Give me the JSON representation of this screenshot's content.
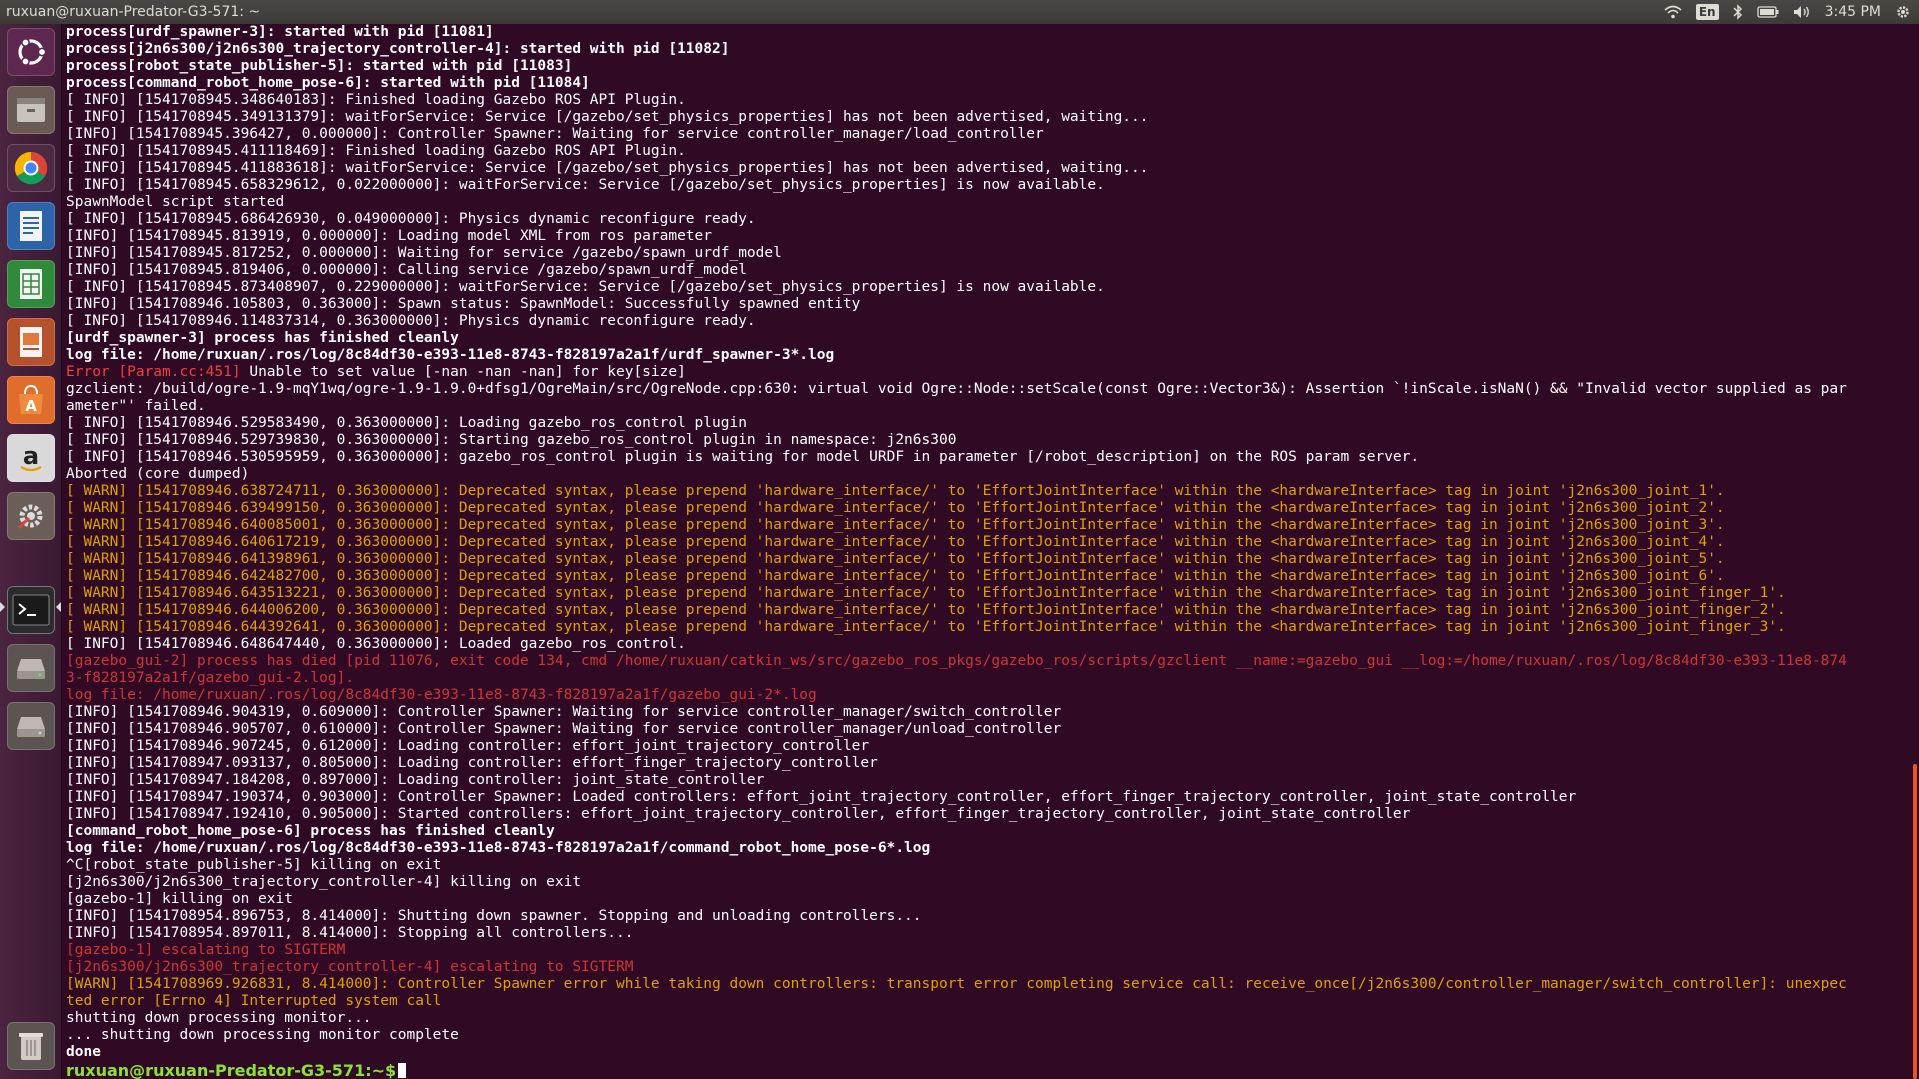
{
  "window": {
    "title": "ruxuan@ruxuan-Predator-G3-571: ~"
  },
  "tray": {
    "keyboard_layout": "En",
    "clock": "3:45 PM"
  },
  "launcher": {
    "items": [
      {
        "name": "ubuntu-dash-icon"
      },
      {
        "name": "files-icon"
      },
      {
        "name": "chrome-icon"
      },
      {
        "name": "writer-icon"
      },
      {
        "name": "calc-icon"
      },
      {
        "name": "impress-icon"
      },
      {
        "name": "software-center-icon"
      },
      {
        "name": "amazon-icon"
      },
      {
        "name": "system-settings-icon"
      },
      {
        "name": "terminal-icon"
      },
      {
        "name": "drive-icon"
      },
      {
        "name": "drive-icon-2"
      },
      {
        "name": "trash-icon"
      }
    ]
  },
  "terminal": {
    "lines": [
      {
        "style": "b",
        "text": "process[urdf_spawner-3]: started with pid [11081]"
      },
      {
        "style": "b",
        "text": "process[j2n6s300/j2n6s300_trajectory_controller-4]: started with pid [11082]"
      },
      {
        "style": "b",
        "text": "process[robot_state_publisher-5]: started with pid [11083]"
      },
      {
        "style": "b",
        "text": "process[command_robot_home_pose-6]: started with pid [11084]"
      },
      {
        "style": "n",
        "text": "[ INFO] [1541708945.348640183]: Finished loading Gazebo ROS API Plugin."
      },
      {
        "style": "n",
        "text": "[ INFO] [1541708945.349131379]: waitForService: Service [/gazebo/set_physics_properties] has not been advertised, waiting..."
      },
      {
        "style": "n",
        "text": "[INFO] [1541708945.396427, 0.000000]: Controller Spawner: Waiting for service controller_manager/load_controller"
      },
      {
        "style": "n",
        "text": "[ INFO] [1541708945.411118469]: Finished loading Gazebo ROS API Plugin."
      },
      {
        "style": "n",
        "text": "[ INFO] [1541708945.411883618]: waitForService: Service [/gazebo/set_physics_properties] has not been advertised, waiting..."
      },
      {
        "style": "n",
        "text": "[ INFO] [1541708945.658329612, 0.022000000]: waitForService: Service [/gazebo/set_physics_properties] is now available."
      },
      {
        "style": "n",
        "text": "SpawnModel script started"
      },
      {
        "style": "n",
        "text": "[ INFO] [1541708945.686426930, 0.049000000]: Physics dynamic reconfigure ready."
      },
      {
        "style": "n",
        "text": "[INFO] [1541708945.813919, 0.000000]: Loading model XML from ros parameter"
      },
      {
        "style": "n",
        "text": "[INFO] [1541708945.817252, 0.000000]: Waiting for service /gazebo/spawn_urdf_model"
      },
      {
        "style": "n",
        "text": "[INFO] [1541708945.819406, 0.000000]: Calling service /gazebo/spawn_urdf_model"
      },
      {
        "style": "n",
        "text": "[ INFO] [1541708945.873408907, 0.229000000]: waitForService: Service [/gazebo/set_physics_properties] is now available."
      },
      {
        "style": "n",
        "text": "[INFO] [1541708946.105803, 0.363000]: Spawn status: SpawnModel: Successfully spawned entity"
      },
      {
        "style": "n",
        "text": "[ INFO] [1541708946.114837314, 0.363000000]: Physics dynamic reconfigure ready."
      },
      {
        "style": "b",
        "text": "[urdf_spawner-3] process has finished cleanly"
      },
      {
        "style": "b",
        "text": "log file: /home/ruxuan/.ros/log/8c84df30-e393-11e8-8743-f828197a2a1f/urdf_spawner-3*.log"
      },
      {
        "style": "errtag",
        "tag": "Error [Param.cc:451]",
        "text": " Unable to set value [-nan -nan -nan] for key[size]"
      },
      {
        "style": "n",
        "text": "gzclient: /build/ogre-1.9-mqY1wq/ogre-1.9-1.9.0+dfsg1/OgreMain/src/OgreNode.cpp:630: virtual void Ogre::Node::setScale(const Ogre::Vector3&): Assertion `!inScale.isNaN() && \"Invalid vector supplied as par"
      },
      {
        "style": "n",
        "text": "ameter\"' failed."
      },
      {
        "style": "n",
        "text": "[ INFO] [1541708946.529583490, 0.363000000]: Loading gazebo_ros_control plugin"
      },
      {
        "style": "n",
        "text": "[ INFO] [1541708946.529739830, 0.363000000]: Starting gazebo_ros_control plugin in namespace: j2n6s300"
      },
      {
        "style": "n",
        "text": "[ INFO] [1541708946.530595959, 0.363000000]: gazebo_ros_control plugin is waiting for model URDF in parameter [/robot_description] on the ROS param server."
      },
      {
        "style": "n",
        "text": "Aborted (core dumped)"
      },
      {
        "style": "warn",
        "text": "[ WARN] [1541708946.638724711, 0.363000000]: Deprecated syntax, please prepend 'hardware_interface/' to 'EffortJointInterface' within the <hardwareInterface> tag in joint 'j2n6s300_joint_1'."
      },
      {
        "style": "warn",
        "text": "[ WARN] [1541708946.639499150, 0.363000000]: Deprecated syntax, please prepend 'hardware_interface/' to 'EffortJointInterface' within the <hardwareInterface> tag in joint 'j2n6s300_joint_2'."
      },
      {
        "style": "warn",
        "text": "[ WARN] [1541708946.640085001, 0.363000000]: Deprecated syntax, please prepend 'hardware_interface/' to 'EffortJointInterface' within the <hardwareInterface> tag in joint 'j2n6s300_joint_3'."
      },
      {
        "style": "warn",
        "text": "[ WARN] [1541708946.640617219, 0.363000000]: Deprecated syntax, please prepend 'hardware_interface/' to 'EffortJointInterface' within the <hardwareInterface> tag in joint 'j2n6s300_joint_4'."
      },
      {
        "style": "warn",
        "text": "[ WARN] [1541708946.641398961, 0.363000000]: Deprecated syntax, please prepend 'hardware_interface/' to 'EffortJointInterface' within the <hardwareInterface> tag in joint 'j2n6s300_joint_5'."
      },
      {
        "style": "warn",
        "text": "[ WARN] [1541708946.642482700, 0.363000000]: Deprecated syntax, please prepend 'hardware_interface/' to 'EffortJointInterface' within the <hardwareInterface> tag in joint 'j2n6s300_joint_6'."
      },
      {
        "style": "warn",
        "text": "[ WARN] [1541708946.643513221, 0.363000000]: Deprecated syntax, please prepend 'hardware_interface/' to 'EffortJointInterface' within the <hardwareInterface> tag in joint 'j2n6s300_joint_finger_1'."
      },
      {
        "style": "warn",
        "text": "[ WARN] [1541708946.644006200, 0.363000000]: Deprecated syntax, please prepend 'hardware_interface/' to 'EffortJointInterface' within the <hardwareInterface> tag in joint 'j2n6s300_joint_finger_2'."
      },
      {
        "style": "warn",
        "text": "[ WARN] [1541708946.644392641, 0.363000000]: Deprecated syntax, please prepend 'hardware_interface/' to 'EffortJointInterface' within the <hardwareInterface> tag in joint 'j2n6s300_joint_finger_3'."
      },
      {
        "style": "n",
        "text": "[ INFO] [1541708946.648647440, 0.363000000]: Loaded gazebo_ros_control."
      },
      {
        "style": "red",
        "text": "[gazebo_gui-2] process has died [pid 11076, exit code 134, cmd /home/ruxuan/catkin_ws/src/gazebo_ros_pkgs/gazebo_ros/scripts/gzclient __name:=gazebo_gui __log:=/home/ruxuan/.ros/log/8c84df30-e393-11e8-874"
      },
      {
        "style": "red",
        "text": "3-f828197a2a1f/gazebo_gui-2.log]."
      },
      {
        "style": "red",
        "text": "log file: /home/ruxuan/.ros/log/8c84df30-e393-11e8-8743-f828197a2a1f/gazebo_gui-2*.log"
      },
      {
        "style": "n",
        "text": "[INFO] [1541708946.904319, 0.609000]: Controller Spawner: Waiting for service controller_manager/switch_controller"
      },
      {
        "style": "n",
        "text": "[INFO] [1541708946.905707, 0.610000]: Controller Spawner: Waiting for service controller_manager/unload_controller"
      },
      {
        "style": "n",
        "text": "[INFO] [1541708946.907245, 0.612000]: Loading controller: effort_joint_trajectory_controller"
      },
      {
        "style": "n",
        "text": "[INFO] [1541708947.093137, 0.805000]: Loading controller: effort_finger_trajectory_controller"
      },
      {
        "style": "n",
        "text": "[INFO] [1541708947.184208, 0.897000]: Loading controller: joint_state_controller"
      },
      {
        "style": "n",
        "text": "[INFO] [1541708947.190374, 0.903000]: Controller Spawner: Loaded controllers: effort_joint_trajectory_controller, effort_finger_trajectory_controller, joint_state_controller"
      },
      {
        "style": "n",
        "text": "[INFO] [1541708947.192410, 0.905000]: Started controllers: effort_joint_trajectory_controller, effort_finger_trajectory_controller, joint_state_controller"
      },
      {
        "style": "b",
        "text": "[command_robot_home_pose-6] process has finished cleanly"
      },
      {
        "style": "b",
        "text": "log file: /home/ruxuan/.ros/log/8c84df30-e393-11e8-8743-f828197a2a1f/command_robot_home_pose-6*.log"
      },
      {
        "style": "n",
        "text": "^C[robot_state_publisher-5] killing on exit"
      },
      {
        "style": "n",
        "text": "[j2n6s300/j2n6s300_trajectory_controller-4] killing on exit"
      },
      {
        "style": "n",
        "text": "[gazebo-1] killing on exit"
      },
      {
        "style": "n",
        "text": "[INFO] [1541708954.896753, 8.414000]: Shutting down spawner. Stopping and unloading controllers..."
      },
      {
        "style": "n",
        "text": "[INFO] [1541708954.897011, 8.414000]: Stopping all controllers..."
      },
      {
        "style": "red",
        "text": "[gazebo-1] escalating to SIGTERM"
      },
      {
        "style": "red",
        "text": "[j2n6s300/j2n6s300_trajectory_controller-4] escalating to SIGTERM"
      },
      {
        "style": "warn",
        "text": "[WARN] [1541708969.926831, 8.414000]: Controller Spawner error while taking down controllers: transport error completing service call: receive_once[/j2n6s300/controller_manager/switch_controller]: unexpec"
      },
      {
        "style": "warn",
        "text": "ted error [Errno 4] Interrupted system call"
      },
      {
        "style": "n",
        "text": "shutting down processing monitor..."
      },
      {
        "style": "n",
        "text": "... shutting down processing monitor complete"
      },
      {
        "style": "b",
        "text": "done"
      }
    ],
    "prompt": "ruxuan@ruxuan-Predator-G3-571:~$"
  },
  "colors": {
    "terminal_bg": "#300a24",
    "warn": "#e0a000",
    "error": "#f04040",
    "prompt": "#8ae234",
    "accent": "#e95420"
  }
}
